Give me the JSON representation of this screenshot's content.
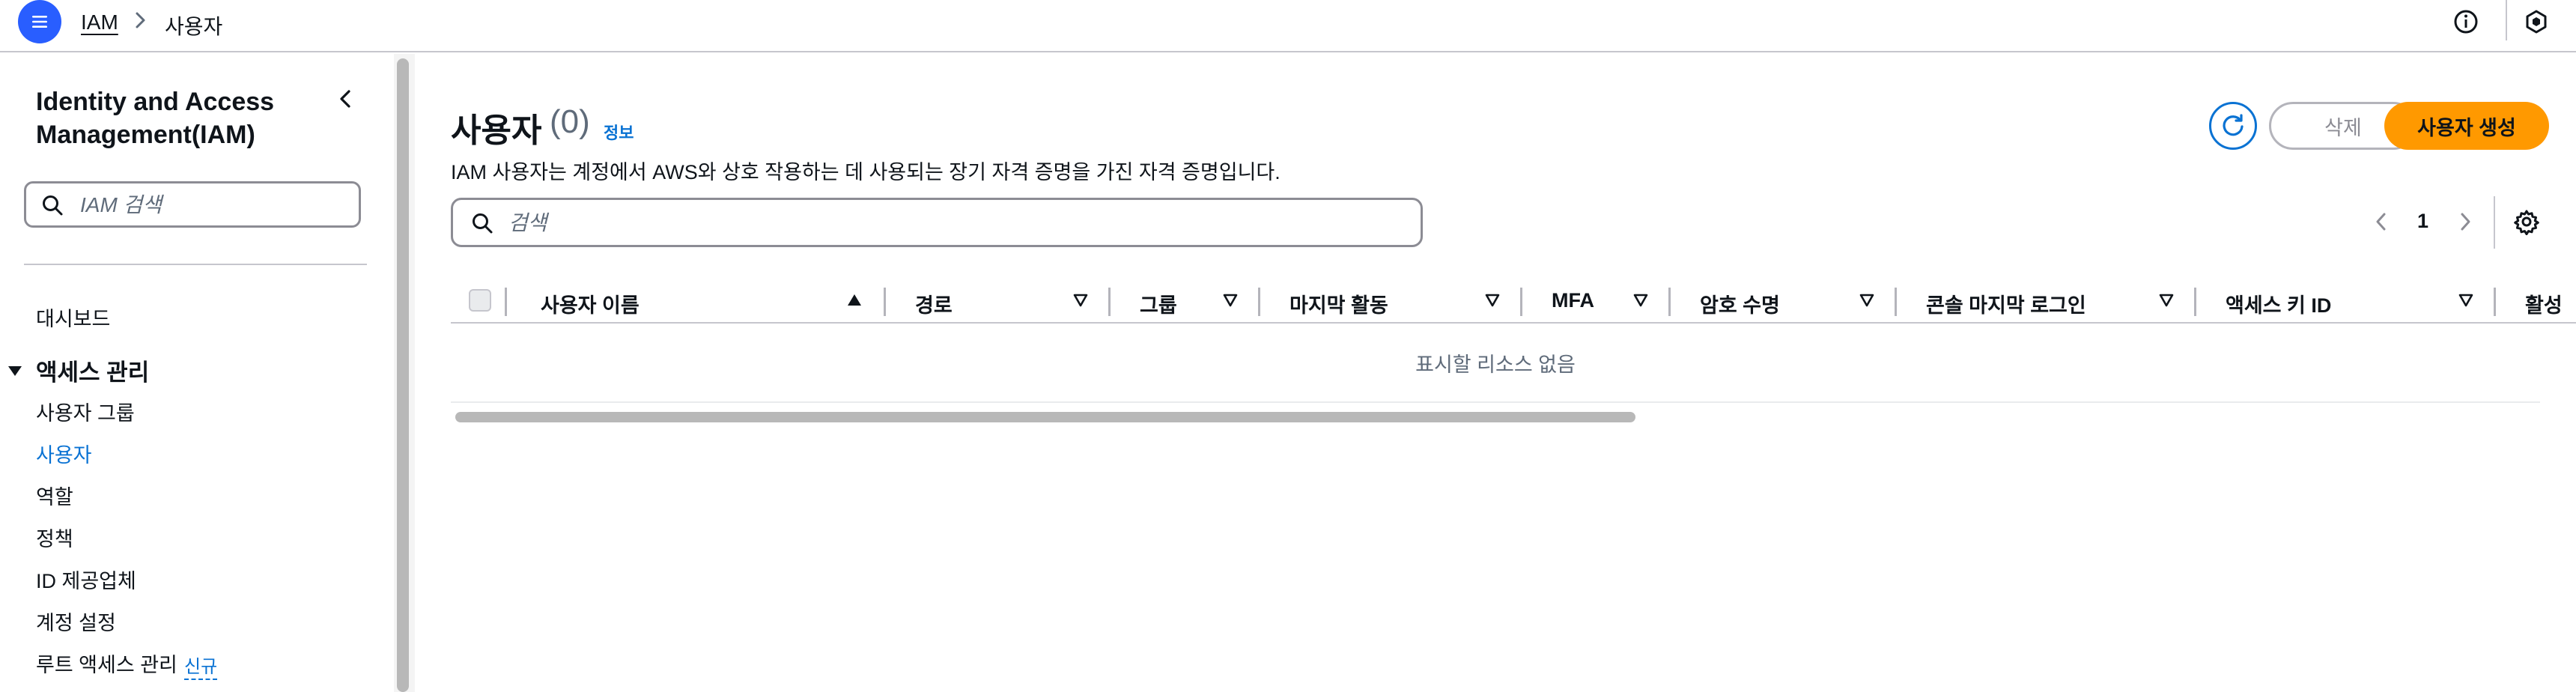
{
  "topbar": {
    "breadcrumb": [
      "IAM",
      "사용자"
    ]
  },
  "sidebar": {
    "title": "Identity and Access Management(IAM)",
    "search_placeholder": "IAM 검색",
    "dashboard": "대시보드",
    "section": "액세스 관리",
    "items": [
      {
        "label": "사용자 그룹",
        "active": false
      },
      {
        "label": "사용자",
        "active": true
      },
      {
        "label": "역할",
        "active": false
      },
      {
        "label": "정책",
        "active": false
      },
      {
        "label": "ID 제공업체",
        "active": false
      },
      {
        "label": "계정 설정",
        "active": false
      },
      {
        "label": "루트 액세스 관리",
        "active": false
      }
    ],
    "new_badge": "신규"
  },
  "main": {
    "title": "사용자",
    "count": "(0)",
    "info": "정보",
    "description": "IAM 사용자는 계정에서 AWS와 상호 작용하는 데 사용되는 장기 자격 증명을 가진 자격 증명입니다.",
    "delete_label": "삭제",
    "create_label": "사용자 생성",
    "search_placeholder": "검색",
    "page": "1",
    "columns": [
      "사용자 이름",
      "경로",
      "그룹",
      "마지막 활동",
      "MFA",
      "암호 수명",
      "콘솔 마지막 로그인",
      "액세스 키 ID",
      "활성"
    ],
    "sort_column": "사용자 이름",
    "empty_text": "표시할 리소스 없음"
  },
  "colors": {
    "accent": "#0972d3",
    "primary_button": "#ff9900",
    "menu_button": "#295eff"
  }
}
